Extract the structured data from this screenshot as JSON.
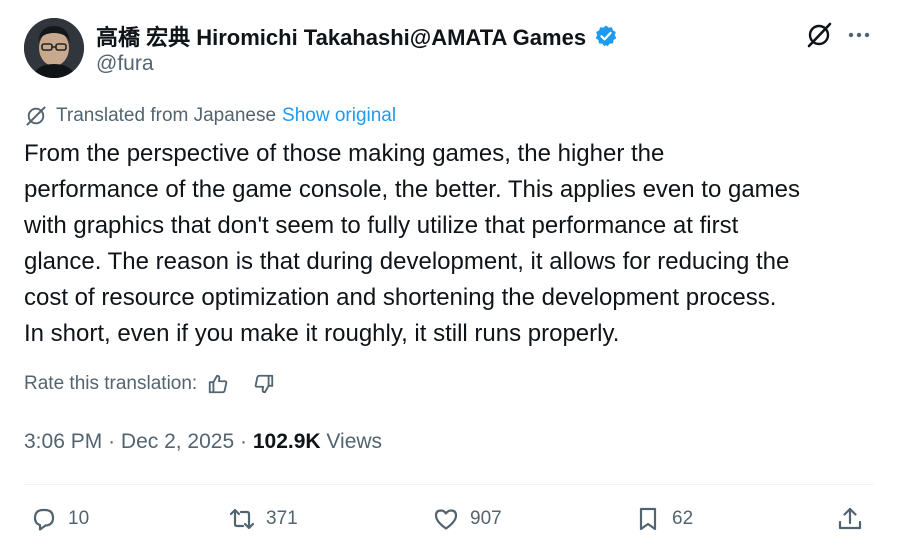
{
  "author": {
    "display_name": "高橋 宏典 Hiromichi Takahashi@AMATA Games",
    "handle": "@fura",
    "verified": true
  },
  "translation": {
    "notice": "Translated from Japanese",
    "show_original_label": "Show original",
    "rate_label": "Rate this translation:"
  },
  "tweet": {
    "text": "From the perspective of those making games, the higher the\nperformance of the game console, the better. This applies even to games\nwith graphics that don't seem to fully utilize that performance at first\nglance. The reason is that during development, it allows for reducing the\ncost of resource optimization and shortening the development process.\nIn short, even if you make it roughly, it still runs properly."
  },
  "meta": {
    "time": "3:06 PM",
    "separator": "·",
    "date": "Dec 2, 2025",
    "views_count": "102.9K",
    "views_label": "Views"
  },
  "actions": {
    "replies": "10",
    "reposts": "371",
    "likes": "907",
    "bookmarks": "62"
  },
  "colors": {
    "text_primary": "#0f1419",
    "text_secondary": "#536471",
    "accent": "#1d9bf0",
    "divider": "#eff3f4"
  },
  "icons": [
    "grok-icon",
    "more-icon",
    "translate-icon",
    "thumbs-up-icon",
    "thumbs-down-icon",
    "reply-icon",
    "repost-icon",
    "like-icon",
    "bookmark-icon",
    "share-icon",
    "verified-badge-icon"
  ]
}
